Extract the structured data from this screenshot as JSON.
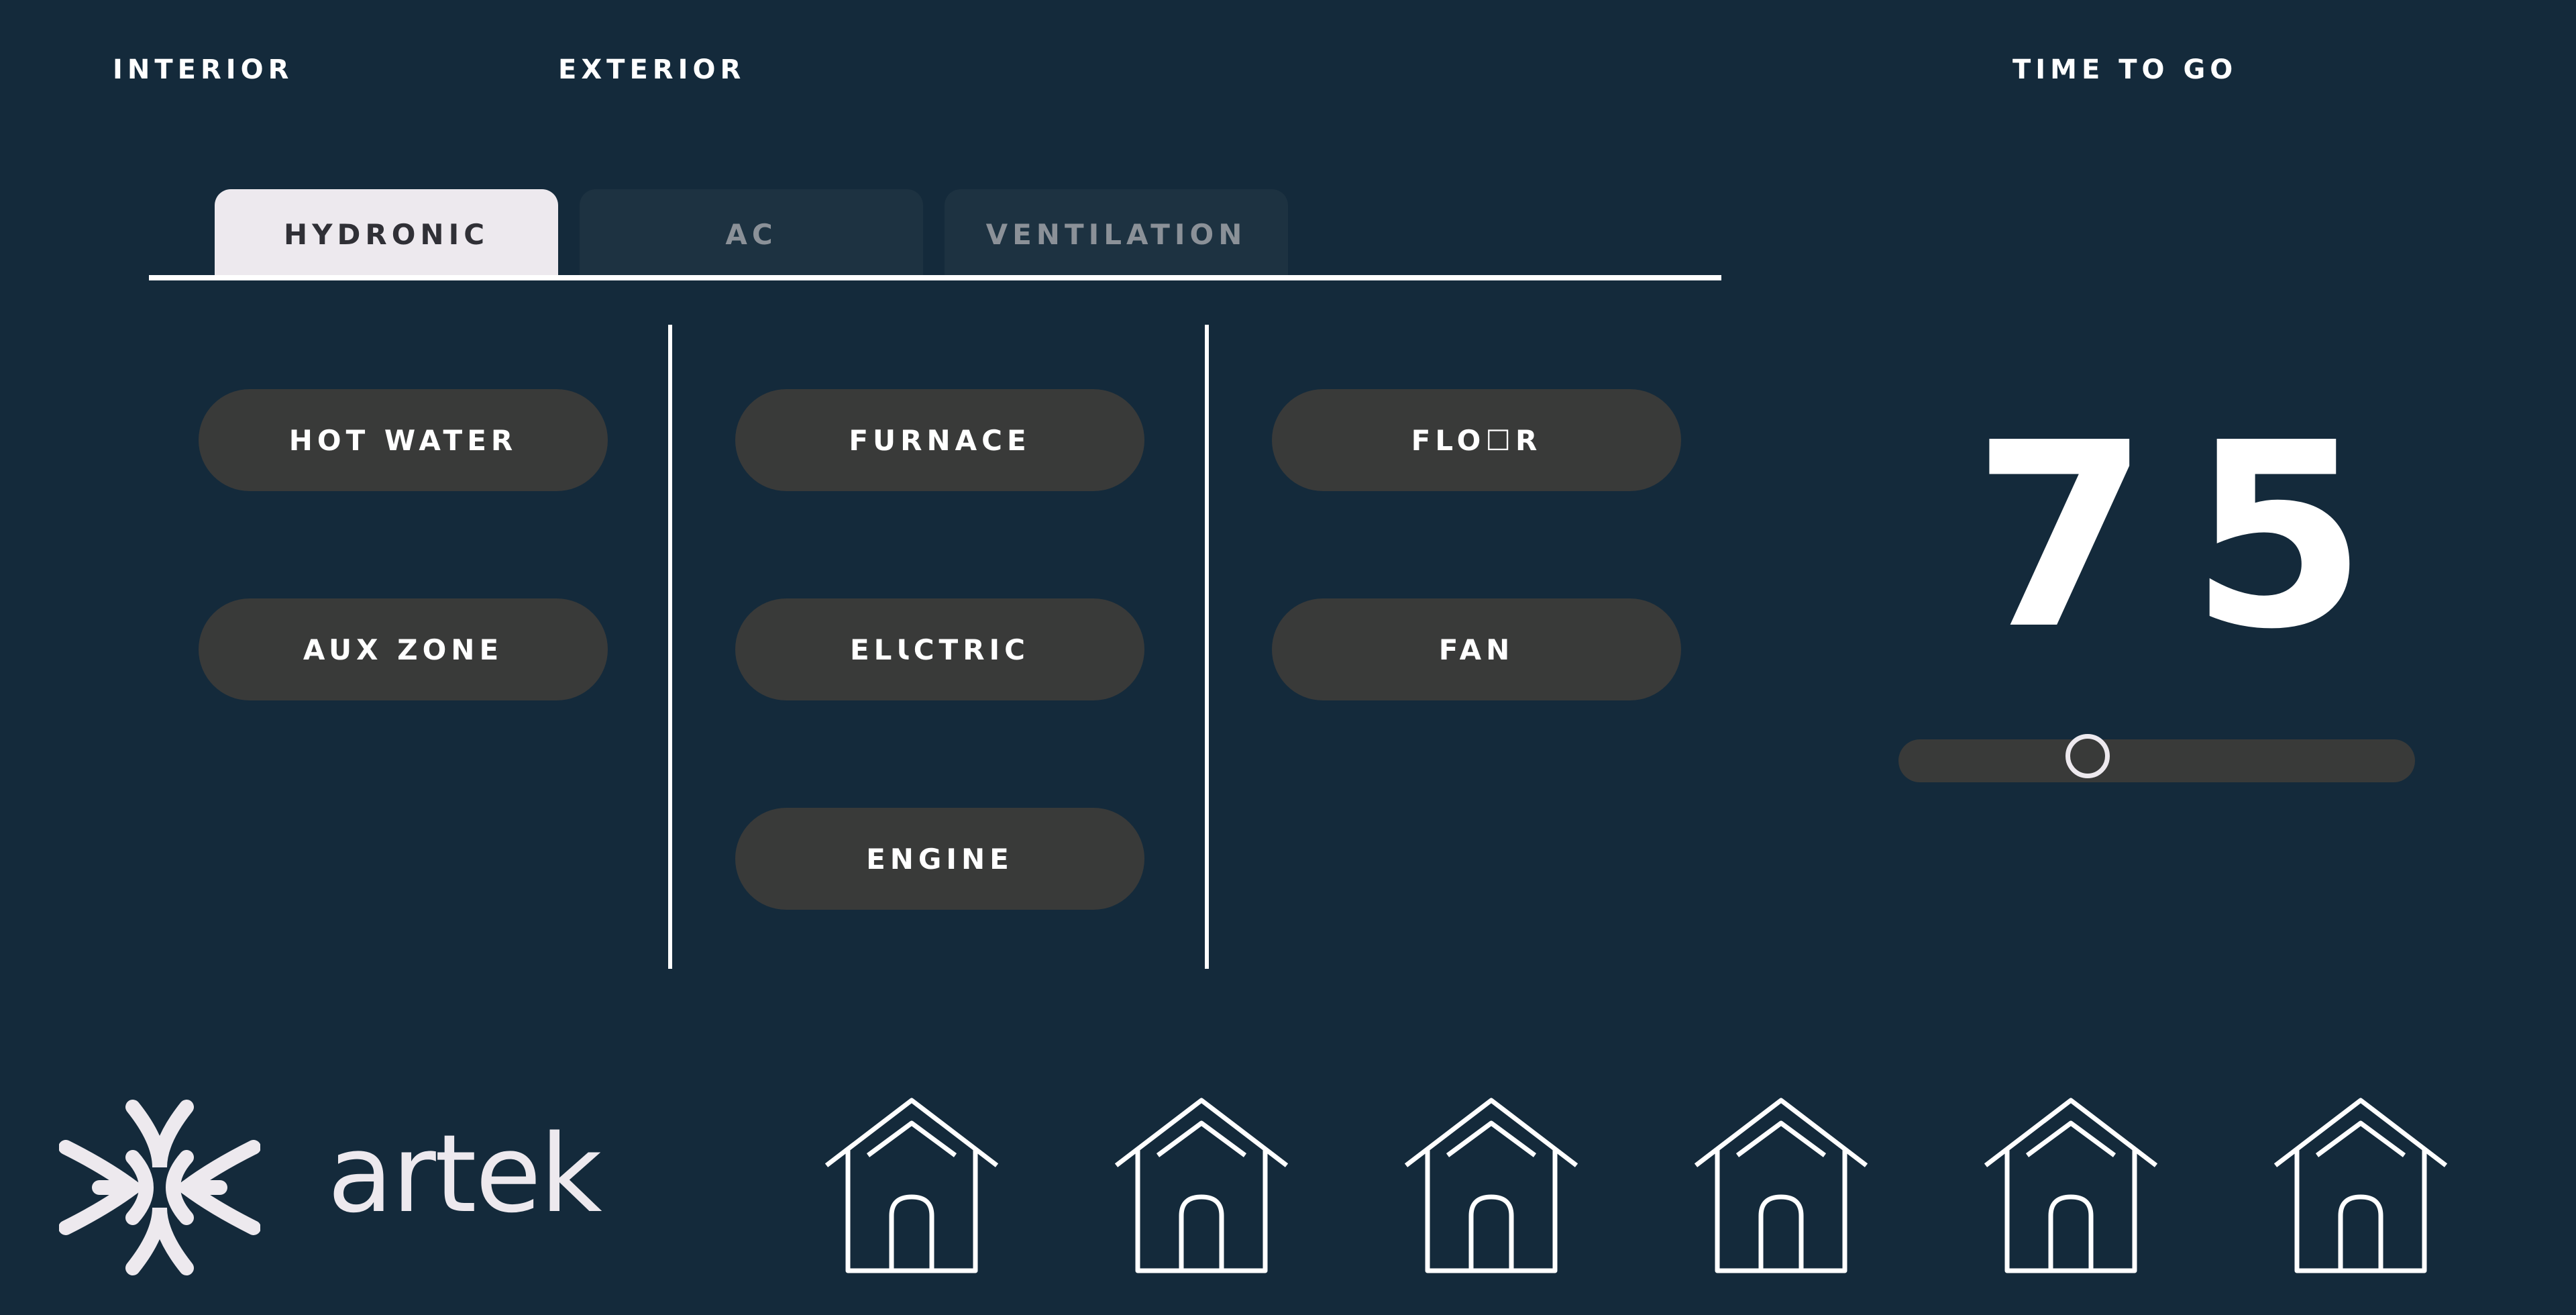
{
  "nav": {
    "interior": "INTERIOR",
    "exterior": "EXTERIOR",
    "time_to_go": "TIME TO GO"
  },
  "tabs": [
    {
      "label": "HYDRONIC",
      "active": true
    },
    {
      "label": "AC",
      "active": false
    },
    {
      "label": "VENTILATION",
      "active": false
    }
  ],
  "controls": {
    "hot_water": "HOT WATER",
    "aux_zone": "AUX ZONE",
    "furnace": "FURNACE",
    "electric": "ELꙆCTRIC",
    "engine": "ENGINE",
    "floor": "FLO☐R",
    "fan": "FAN"
  },
  "temperature": {
    "value": "75",
    "slider_fraction": 0.366
  },
  "brand": {
    "name": "artek"
  },
  "zones": [
    {
      "icon": "house-icon"
    },
    {
      "icon": "house-icon"
    },
    {
      "icon": "house-icon"
    },
    {
      "icon": "house-icon"
    },
    {
      "icon": "house-icon"
    },
    {
      "icon": "house-icon"
    }
  ],
  "colors": {
    "background": "#142a3b",
    "pill": "#393a39",
    "active_tab": "#ede9ee",
    "inactive_tab": "#1d3241",
    "text": "#ffffff"
  }
}
